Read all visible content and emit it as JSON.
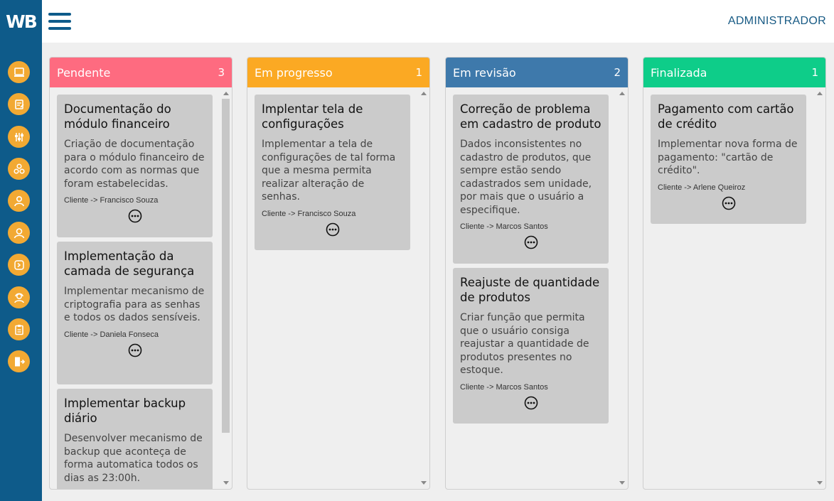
{
  "app": {
    "logo": "WB",
    "user": "ADMINISTRADOR"
  },
  "sidebar": {
    "items": [
      {
        "icon": "computer-icon"
      },
      {
        "icon": "edit-document-icon"
      },
      {
        "icon": "sliders-icon"
      },
      {
        "icon": "modules-icon"
      },
      {
        "icon": "user-icon"
      },
      {
        "icon": "user-circle-icon"
      },
      {
        "icon": "terminal-icon"
      },
      {
        "icon": "support-agent-icon"
      },
      {
        "icon": "clipboard-icon"
      },
      {
        "icon": "logout-icon"
      }
    ]
  },
  "colors": {
    "primary": "#0e5b8a",
    "pendente": "#fe6b80",
    "em_progresso": "#fba923",
    "em_revisao": "#3e79ab",
    "finalizada": "#0ecd89",
    "sidebar_button": "#f2a933"
  },
  "columns": [
    {
      "title": "Pendente",
      "count": "3",
      "cards": [
        {
          "title": "Documentação do módulo financeiro",
          "description": "Criação de documentação para o módulo financeiro de acordo com as normas que foram estabelecidas.",
          "client": "Cliente -> Francisco Souza"
        },
        {
          "title": "Implementação da camada de segurança",
          "description": "Implementar mecanismo de criptografia para as senhas e todos os dados sensíveis.",
          "client": "Cliente -> Daniela Fonseca"
        },
        {
          "title": "Implementar backup diário",
          "description": "Desenvolver mecanismo de backup que aconteça de forma automatica todos os dias as 23:00h.",
          "client": ""
        }
      ]
    },
    {
      "title": "Em progresso",
      "count": "1",
      "cards": [
        {
          "title": "Implentar tela de configurações",
          "description": "Implementar a tela de configurações de tal forma que a mesma permita realizar alteração de senhas.",
          "client": "Cliente -> Francisco Souza"
        }
      ]
    },
    {
      "title": "Em revisão",
      "count": "2",
      "cards": [
        {
          "title": "Correção de problema em cadastro de produto",
          "description": "Dados inconsistentes no cadastro de produtos, que sempre estão sendo cadastrados sem unidade, por mais que o usuário a especifique.",
          "client": "Cliente -> Marcos Santos"
        },
        {
          "title": "Reajuste de quantidade de produtos",
          "description": "Criar função que permita que o usuário consiga reajustar a quantidade de produtos presentes no estoque.",
          "client": "Cliente -> Marcos Santos"
        }
      ]
    },
    {
      "title": "Finalizada",
      "count": "1",
      "cards": [
        {
          "title": "Pagamento com cartão de crédito",
          "description": "Implementar nova forma de pagamento: \"cartão de crédito\".",
          "client": "Cliente -> Arlene Queiroz"
        }
      ]
    }
  ]
}
